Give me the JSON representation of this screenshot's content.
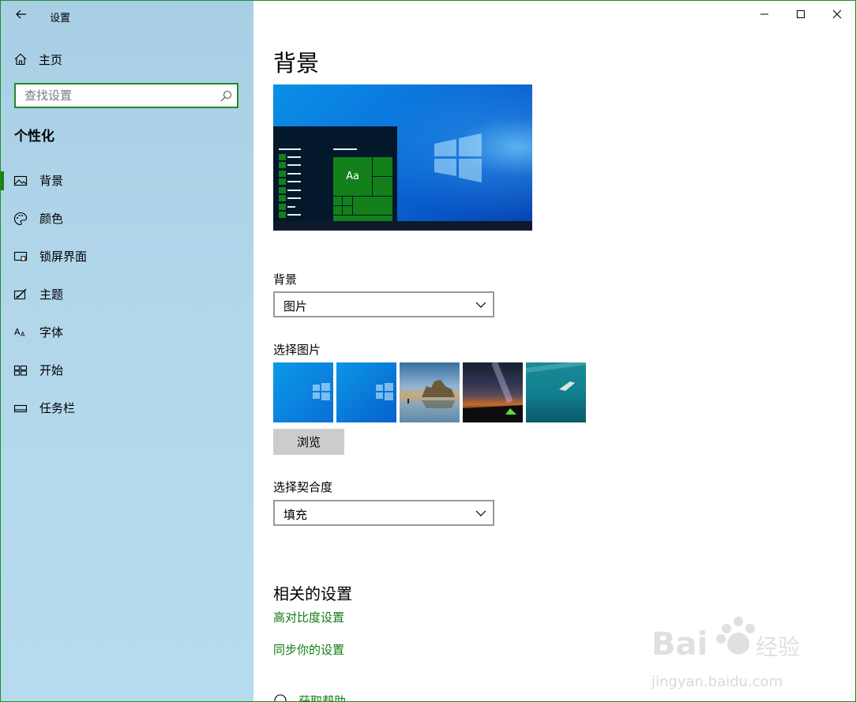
{
  "window": {
    "app_title": "设置",
    "controls": [
      "minimize-icon",
      "maximize-icon",
      "close-icon"
    ]
  },
  "sidebar": {
    "home_label": "主页",
    "search_placeholder": "查找设置",
    "section_title": "个性化",
    "items": [
      {
        "label": "背景",
        "icon": "image-icon",
        "active": true
      },
      {
        "label": "颜色",
        "icon": "palette-icon",
        "active": false
      },
      {
        "label": "锁屏界面",
        "icon": "lock-screen-icon",
        "active": false
      },
      {
        "label": "主题",
        "icon": "theme-icon",
        "active": false
      },
      {
        "label": "字体",
        "icon": "font-icon",
        "active": false
      },
      {
        "label": "开始",
        "icon": "start-icon",
        "active": false
      },
      {
        "label": "任务栏",
        "icon": "taskbar-icon",
        "active": false
      }
    ]
  },
  "main": {
    "title": "背景",
    "preview": {
      "tile_text": "Aa"
    },
    "background": {
      "label": "背景",
      "selected": "图片"
    },
    "choose_picture": {
      "label": "选择图片",
      "thumbnails": [
        "windows-blue-light",
        "windows-blue",
        "sea-rocks-sunset",
        "night-sky-tent",
        "underwater-swimmer"
      ]
    },
    "browse_label": "浏览",
    "fit": {
      "label": "选择契合度",
      "selected": "填充"
    },
    "related": {
      "title": "相关的设置",
      "links": [
        "高对比度设置",
        "同步你的设置"
      ]
    },
    "help_label": "获取帮助"
  },
  "watermark": {
    "text": "jingyan.baidu.com",
    "logo": "Bai du 经验"
  },
  "colors": {
    "accent": "#107c10",
    "sidebar_bg": "#b1d6ea",
    "preview_blue": "#0a79de"
  }
}
